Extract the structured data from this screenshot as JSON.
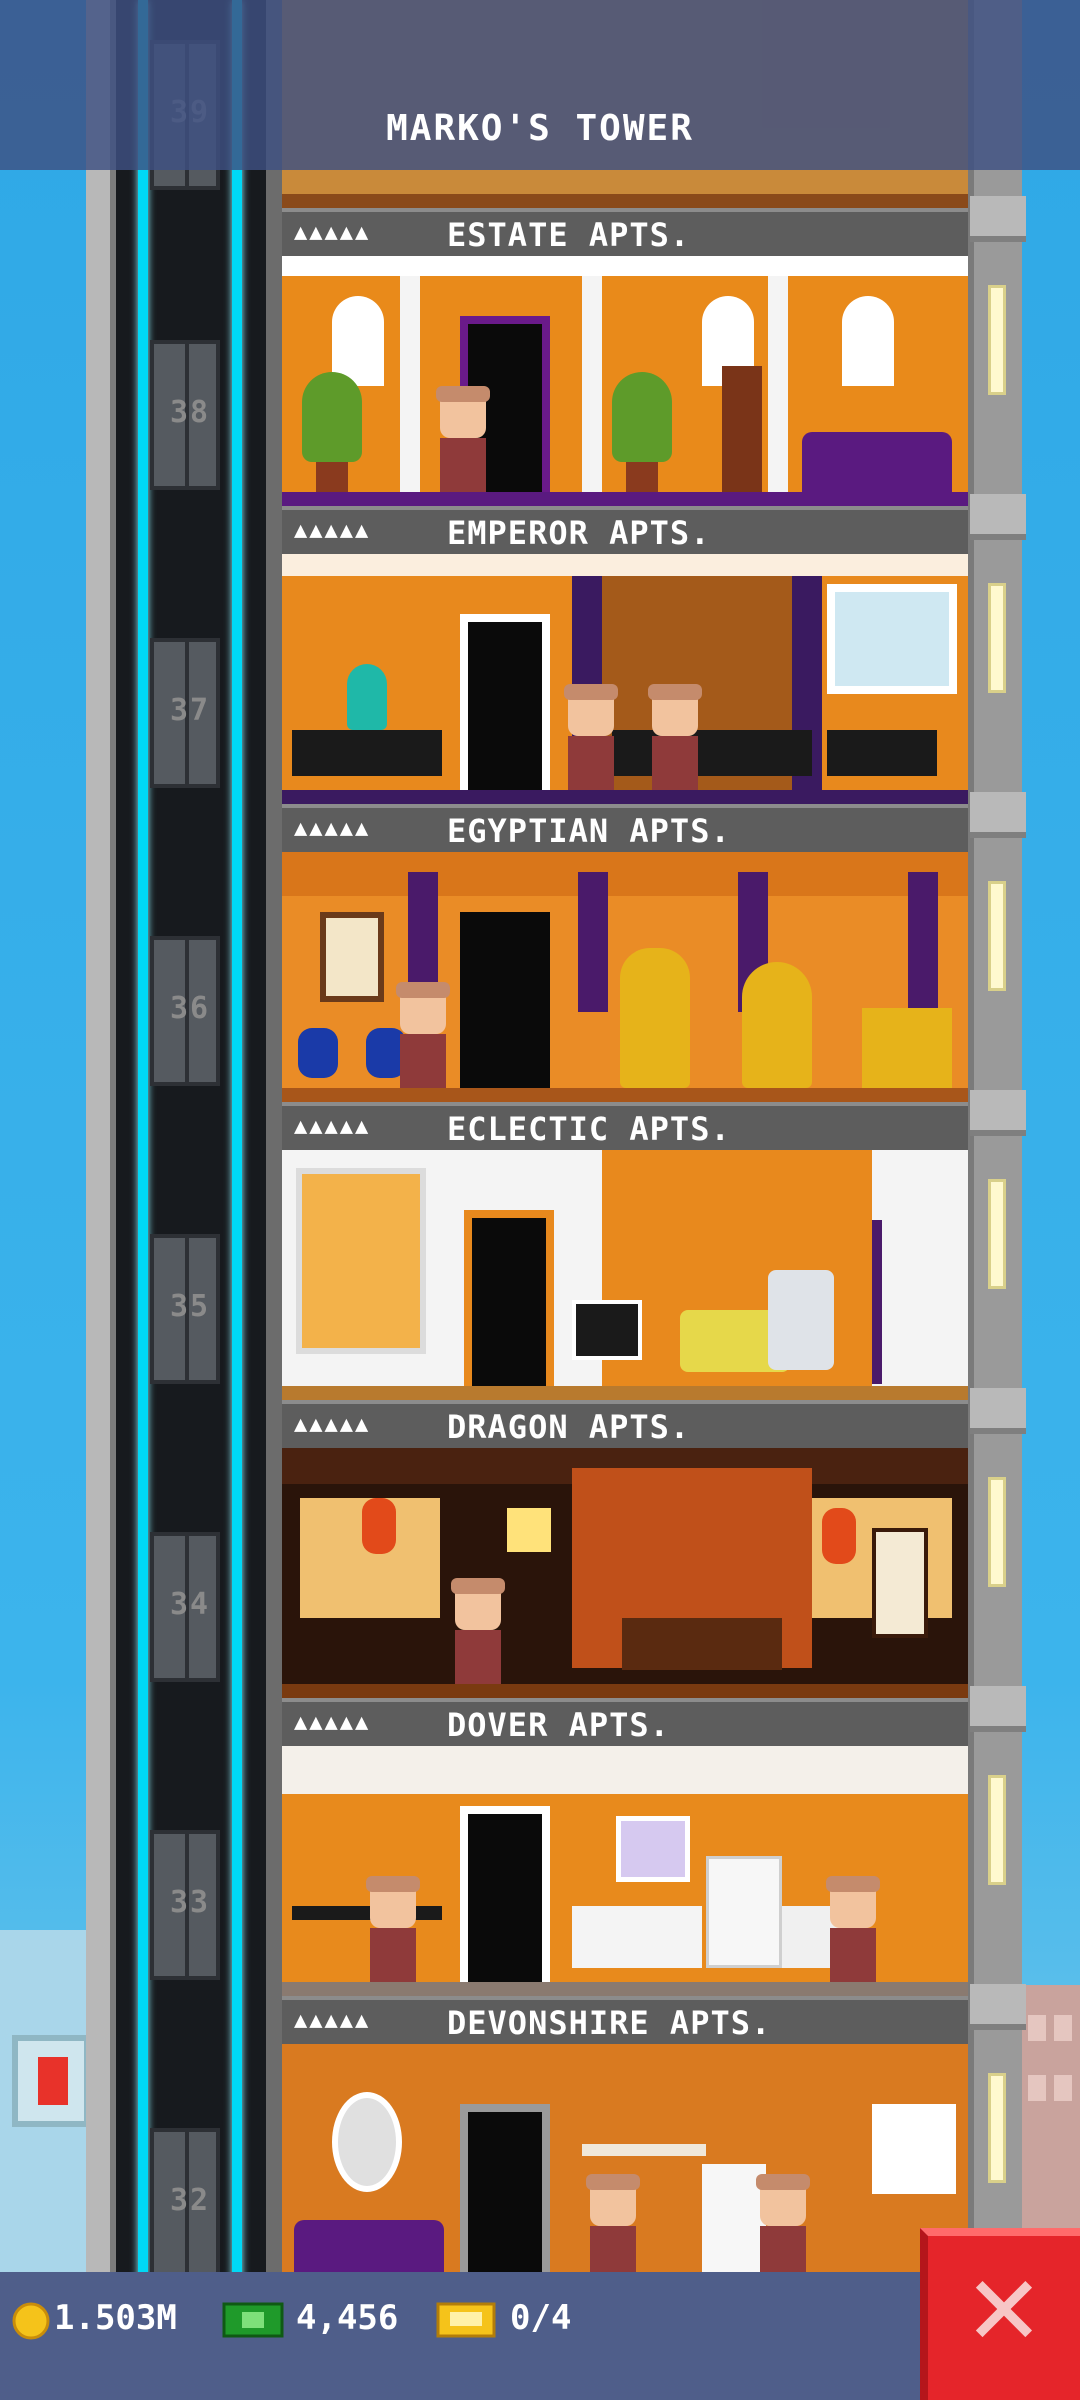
{
  "header": {
    "title": "MARKO'S TOWER"
  },
  "floors": [
    {
      "number": "39",
      "name": "",
      "stars": ""
    },
    {
      "number": "38",
      "name": "ESTATE APTS.",
      "stars": "▲▲▲▲▲"
    },
    {
      "number": "37",
      "name": "EMPEROR APTS.",
      "stars": "▲▲▲▲▲"
    },
    {
      "number": "36",
      "name": "EGYPTIAN APTS.",
      "stars": "▲▲▲▲▲"
    },
    {
      "number": "35",
      "name": "ECLECTIC APTS.",
      "stars": "▲▲▲▲▲"
    },
    {
      "number": "34",
      "name": "DRAGON APTS.",
      "stars": "▲▲▲▲▲"
    },
    {
      "number": "33",
      "name": "DOVER APTS.",
      "stars": "▲▲▲▲▲"
    },
    {
      "number": "32",
      "name": "DEVONSHIRE APTS.",
      "stars": "▲▲▲▲▲"
    }
  ],
  "stats": {
    "coins": "1.503M",
    "bux": "4,456",
    "tickets": "0/4"
  },
  "icons": {
    "coin": "coin-icon",
    "bux": "bux-icon",
    "ticket": "ticket-icon",
    "close": "close-icon"
  },
  "colors": {
    "rail": "#00d9f5",
    "close_button": "#e5252a",
    "room_wall": "#e68a1c"
  }
}
